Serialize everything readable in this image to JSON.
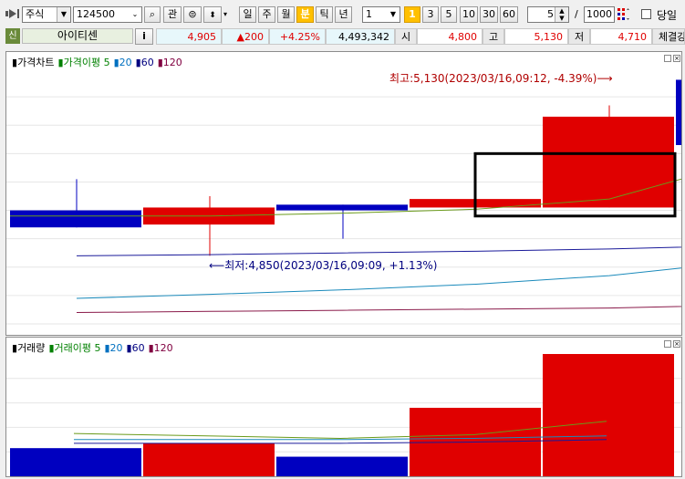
{
  "toolbar": {
    "market_type": "주식",
    "stock_code": "124500",
    "fav_label": "관",
    "periods": [
      "일",
      "주",
      "월",
      "분",
      "틱",
      "년"
    ],
    "active_period": "분",
    "interval_value": "1",
    "quick_intervals": [
      "1",
      "3",
      "5",
      "10",
      "30",
      "60"
    ],
    "active_quick": "1",
    "count_value": "5",
    "slash": "/",
    "max_count": "1000",
    "today_label": "당일"
  },
  "info": {
    "badge": "신",
    "stock_name": "아이티센",
    "info_button": "i",
    "price": "4,905",
    "change": "▲200",
    "change_pct": "+4.25%",
    "volume": "4,493,342",
    "open_label": "시",
    "open_value": "4,800",
    "high_label": "고",
    "high_value": "5,130",
    "low_label": "저",
    "low_value": "4,710",
    "trade_label": "체결강"
  },
  "price_panel": {
    "legend": [
      {
        "text": "가격차트",
        "color": "#000000"
      },
      {
        "text": "가격이평 5",
        "color": "#008000"
      },
      {
        "text": "20",
        "color": "#0070c0"
      },
      {
        "text": "60",
        "color": "#000080"
      },
      {
        "text": "120",
        "color": "#800040"
      }
    ],
    "high_annotation": "최고:5,130(2023/03/16,09:12, -4.39%)⟶",
    "low_annotation": "⟵최저:4,850(2023/03/16,09:09, +1.13%)"
  },
  "volume_panel": {
    "legend": [
      {
        "text": "거래량",
        "color": "#000000"
      },
      {
        "text": "거래이평 5",
        "color": "#008000"
      },
      {
        "text": "20",
        "color": "#0070c0"
      },
      {
        "text": "60",
        "color": "#000080"
      },
      {
        "text": "120",
        "color": "#800040"
      }
    ]
  },
  "colors": {
    "up": "#e00000",
    "down": "#0000c0",
    "ma5": "#6a9a1a",
    "ma20": "#1a8abb",
    "ma60": "#1a1a9a",
    "ma120": "#8a1a4a"
  },
  "chart_data": [
    {
      "type": "candlestick",
      "title": "가격차트",
      "ylim": [
        4700,
        5150
      ],
      "candles": [
        {
          "open": 4900,
          "close": 4870,
          "high": 4955,
          "low": 4870
        },
        {
          "open": 4875,
          "close": 4905,
          "high": 4925,
          "low": 4820
        },
        {
          "open": 4910,
          "close": 4900,
          "high": 4910,
          "low": 4850
        },
        {
          "open": 4905,
          "close": 4920,
          "high": 4920,
          "low": 4900
        },
        {
          "open": 4905,
          "close": 5065,
          "high": 5085,
          "low": 4905
        },
        {
          "open": 5130,
          "close": 5015,
          "high": 5145,
          "low": 4905
        }
      ],
      "series": [
        {
          "name": "가격이평 5",
          "values": [
            4890,
            4890,
            4895,
            4902,
            4920,
            4985
          ]
        },
        {
          "name": "20",
          "values": [
            4745,
            4752,
            4760,
            4770,
            4785,
            4810
          ]
        },
        {
          "name": "60",
          "values": [
            4820,
            4822,
            4825,
            4828,
            4832,
            4838
          ]
        },
        {
          "name": "120",
          "values": [
            4720,
            4722,
            4724,
            4726,
            4728,
            4733
          ]
        }
      ]
    },
    {
      "type": "bar",
      "title": "거래량",
      "ylim": [
        0,
        100
      ],
      "values": [
        23,
        27,
        16,
        56,
        100
      ],
      "directions": [
        "down",
        "up",
        "down",
        "up",
        "up"
      ],
      "series": [
        {
          "name": "거래이평 5",
          "values": [
            35,
            33,
            31,
            34,
            45
          ]
        },
        {
          "name": "20",
          "values": [
            30,
            30,
            30,
            31,
            33
          ]
        },
        {
          "name": "60",
          "values": [
            27,
            27,
            27,
            28,
            30
          ]
        }
      ]
    }
  ]
}
